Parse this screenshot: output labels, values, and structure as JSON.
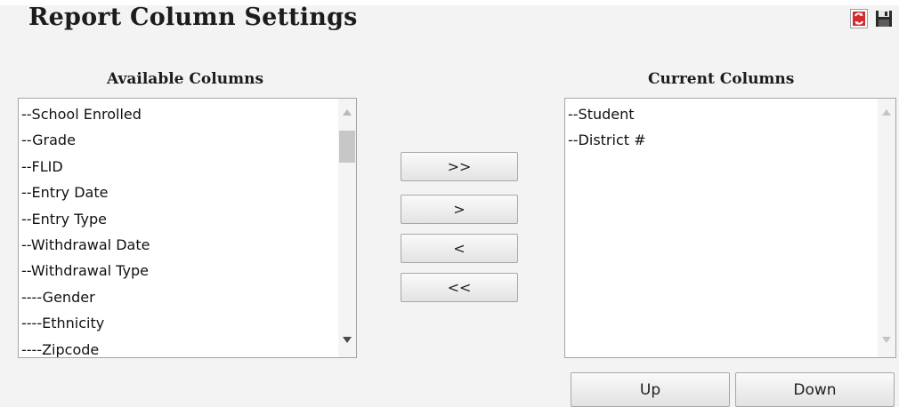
{
  "page": {
    "title": "Report Column Settings"
  },
  "header_icons": {
    "refresh": "refresh-icon",
    "save": "save-icon"
  },
  "available": {
    "heading": "Available Columns",
    "items": [
      "--School Enrolled",
      "--Grade",
      "--FLID",
      "--Entry Date",
      "--Entry Type",
      "--Withdrawal Date",
      "--Withdrawal Type",
      "----Gender",
      "----Ethnicity",
      "----Zipcode"
    ]
  },
  "current": {
    "heading": "Current Columns",
    "items": [
      "--Student",
      "--District #"
    ]
  },
  "buttons": {
    "add_all": ">>",
    "add": ">",
    "remove": "<",
    "remove_all": "<<",
    "up": "Up",
    "down": "Down"
  },
  "colors": {
    "refresh_icon_red": "#d12b2b",
    "save_icon": "#2a2a2a"
  }
}
